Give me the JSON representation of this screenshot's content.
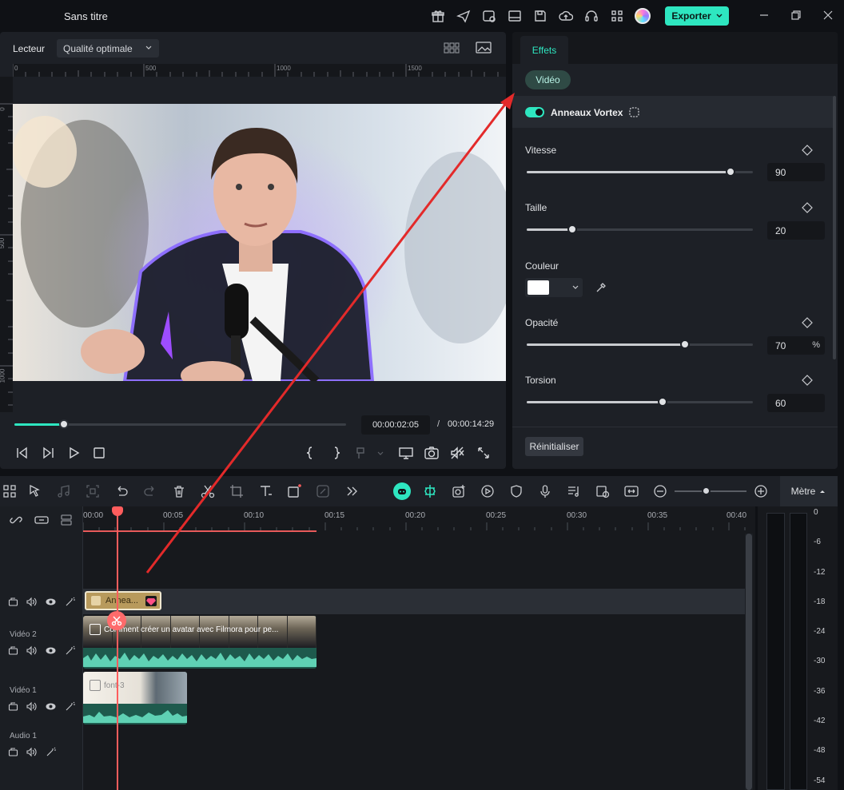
{
  "app": {
    "title": "Sans titre",
    "export_label": "Exporter"
  },
  "player": {
    "label": "Lecteur",
    "quality": "Qualité optimale",
    "ruler_h": [
      "0",
      "500",
      "1000",
      "1500"
    ],
    "ruler_v": [
      "0",
      "500",
      "1000"
    ],
    "current_time": "00:00:02:05",
    "separator": "/",
    "total_time": "00:00:14:29",
    "progress": 0.15
  },
  "effects": {
    "tab": "Effets",
    "category": "Vidéo",
    "effect_name": "Anneaux Vortex",
    "params": {
      "speed": {
        "label": "Vitesse",
        "value": "90",
        "fraction": 0.9
      },
      "size": {
        "label": "Taille",
        "value": "20",
        "fraction": 0.2
      },
      "color": {
        "label": "Couleur",
        "swatch": "#ffffff"
      },
      "opacity": {
        "label": "Opacité",
        "value": "70",
        "unit": "%",
        "fraction": 0.7
      },
      "twist": {
        "label": "Torsion",
        "value": "60",
        "fraction": 0.6
      }
    },
    "reset_label": "Réinitialiser"
  },
  "timeline": {
    "meter_label": "Mètre",
    "timecodes": [
      "00:00",
      "00:05",
      "00:10",
      "00:15",
      "00:20",
      "00:25",
      "00:30",
      "00:35",
      "00:40"
    ],
    "tracks": [
      {
        "name": "Vidéo 2"
      },
      {
        "name": "Vidéo 1"
      },
      {
        "name": "Audio 1"
      }
    ],
    "clip_effect": "Annea...",
    "clip_v2_title": "Comment créer un avatar avec Filmora pour pe...",
    "clip_v1_title": "font-3"
  },
  "meter": {
    "db": [
      "0",
      "-6",
      "-12",
      "-18",
      "-24",
      "-30",
      "-36",
      "-42",
      "-48",
      "-54"
    ]
  },
  "colors": {
    "accent": "#2ee6c0",
    "playhead": "#ff5d5d",
    "annotation_arrow": "#e32a2a"
  }
}
